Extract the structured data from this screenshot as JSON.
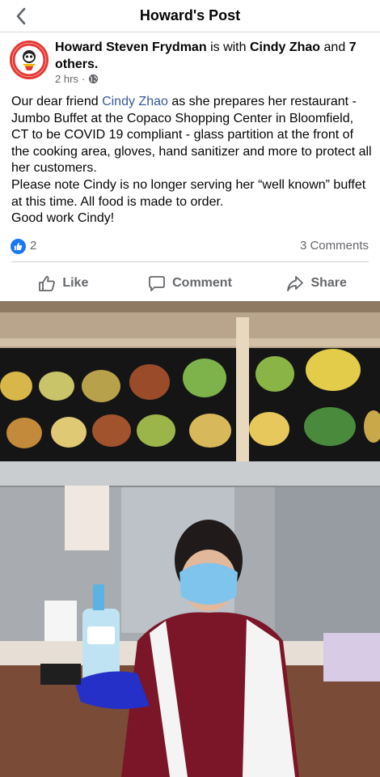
{
  "header": {
    "title": "Howard's Post",
    "back_icon": "chevron-left-icon"
  },
  "post": {
    "author": "Howard Steven Frydman",
    "with_text": "is with",
    "tagged": "Cindy Zhao",
    "and_text": "and",
    "others": "7 others",
    "time": "2 hrs",
    "separator": "·",
    "privacy_icon": "globe-icon",
    "text": {
      "mention": "Cindy Zhao",
      "p1_before": "Our dear friend ",
      "p1_after": "  as she prepares her restaurant - Jumbo Buffet at the Copaco Shopping Center in Bloomfield, CT to be COVID 19  compliant - glass partition at the front of the cooking area, gloves, hand sanitizer and more to protect all her customers.",
      "p2": "Please note Cindy is no longer serving her “well known” buffet at this time. All food is made to order.",
      "p3": "Good work Cindy!"
    }
  },
  "stats": {
    "likes": "2",
    "comments": "3 Comments",
    "reaction_icon": "thumbs-up-icon"
  },
  "actions": {
    "like": "Like",
    "comment": "Comment",
    "share": "Share"
  },
  "colors": {
    "accent": "#1877f2",
    "mention": "#385898",
    "secondary_text": "#65676b",
    "divider": "#ced0d4",
    "avatar_ring": "#e53935"
  },
  "photo": {
    "subject": "restaurant-counter-photo"
  }
}
